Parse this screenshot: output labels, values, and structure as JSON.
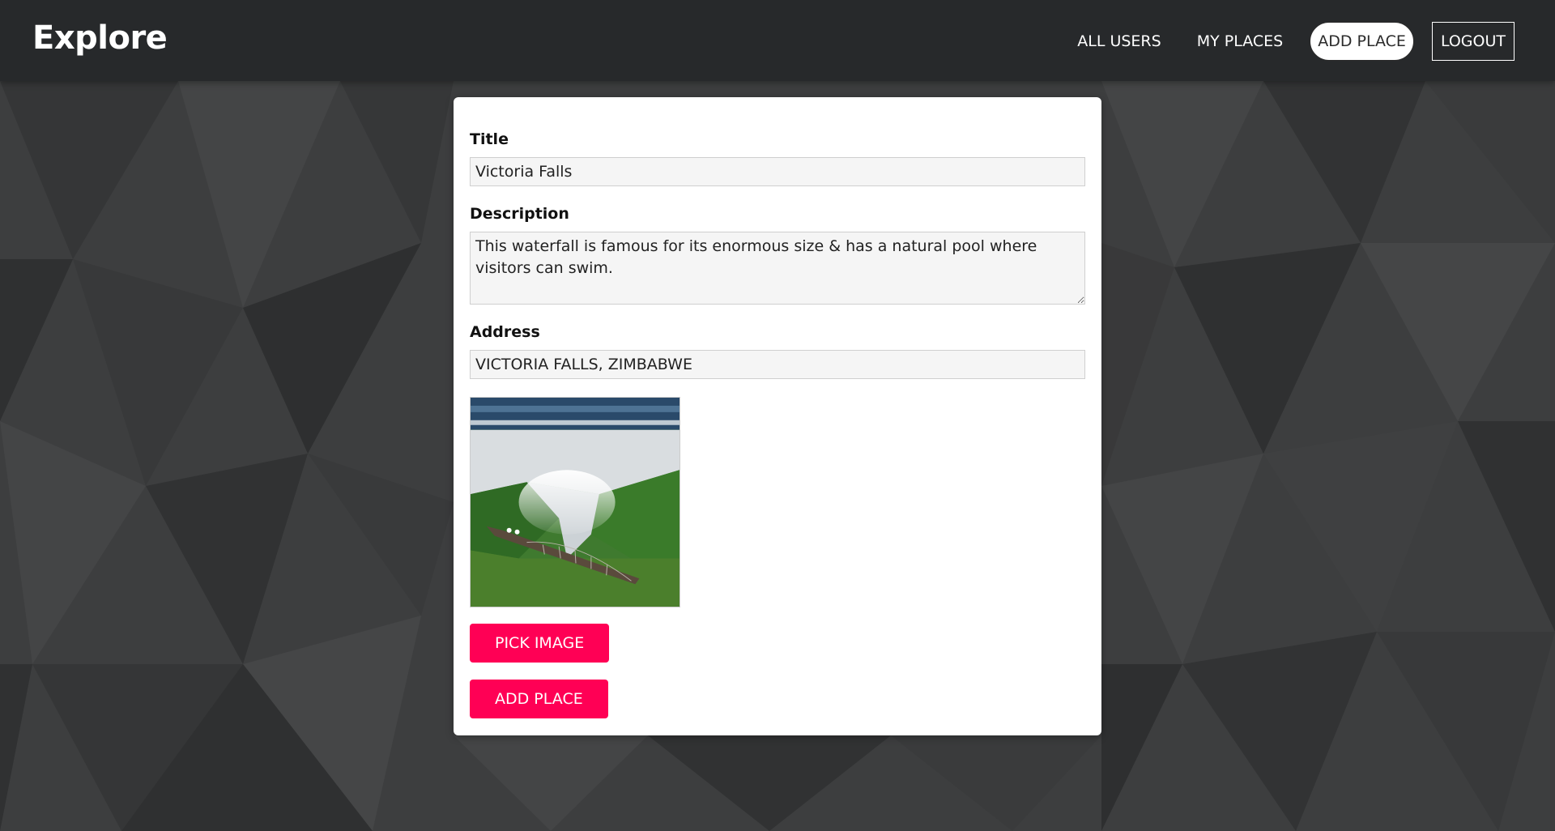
{
  "header": {
    "brand": "Explore",
    "nav": {
      "all_users": "ALL USERS",
      "my_places": "MY PLACES",
      "add_place": "ADD PLACE",
      "logout": "LOGOUT"
    }
  },
  "form": {
    "title_label": "Title",
    "title_value": "Victoria Falls",
    "description_label": "Description",
    "description_value": "This waterfall is famous for its enormous size & has a natural pool where visitors can swim.",
    "address_label": "Address",
    "address_value": "VICTORIA FALLS, ZIMBABWE",
    "pick_image_label": "PICK IMAGE",
    "submit_label": "ADD PLACE"
  },
  "colors": {
    "header_bg": "#27292b",
    "page_bg": "#3b3c3d",
    "accent": "#ff0055"
  }
}
